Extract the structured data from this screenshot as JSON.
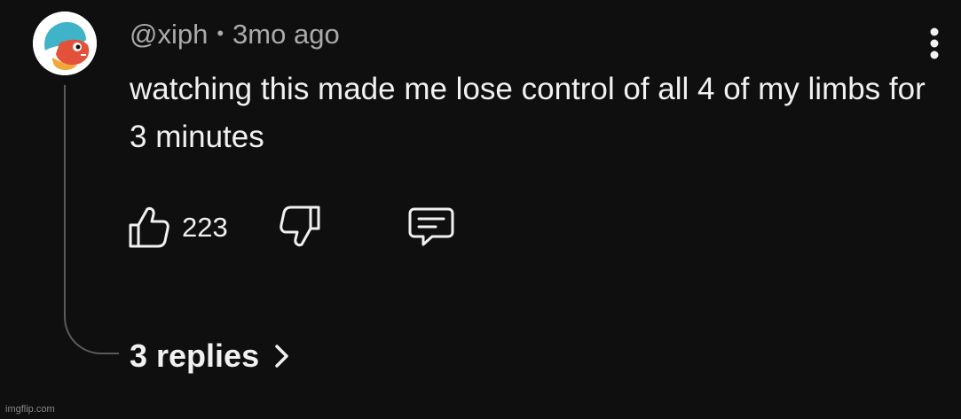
{
  "comment": {
    "author": "@xiph",
    "separator": "•",
    "timestamp": "3mo ago",
    "text": "watching this made me lose control of all 4 of my limbs for 3 minutes",
    "like_count": "223",
    "replies_label": "3 replies"
  },
  "icons": {
    "avatar": "avatar-image",
    "more": "more-vert-icon",
    "like": "thumbs-up-icon",
    "dislike": "thumbs-down-icon",
    "reply": "reply-comment-icon",
    "chevron": "chevron-right-icon"
  },
  "colors": {
    "background": "#0f0f0f",
    "primary_text": "#f1f1f1",
    "secondary_text": "#aaaaaa",
    "thread_line": "#5a5a5a"
  },
  "watermark": "imgflip.com"
}
